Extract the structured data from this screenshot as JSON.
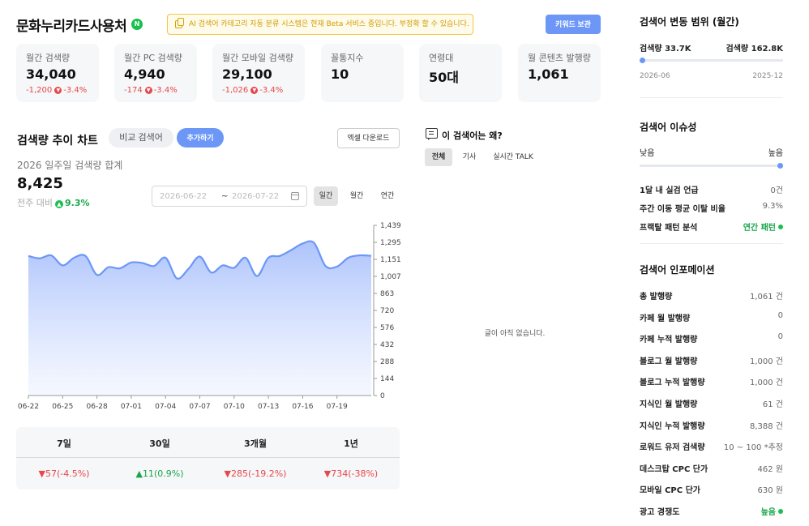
{
  "header": {
    "keyword": "문화누리카드사용처",
    "badge": "N",
    "beta_notice": "AI 검색어 카테고리 자동 분류 시스템은 현재 Beta 서비스 중입니다. 부정확 할 수 있습니다.",
    "report_button": "키워드 보관"
  },
  "stats": [
    {
      "label": "월간 검색량",
      "value": "34,040",
      "change": "-1,200",
      "change_pct": "-3.4%"
    },
    {
      "label": "월간 PC 검색량",
      "value": "4,940",
      "change": "-174",
      "change_pct": "-3.4%"
    },
    {
      "label": "월간 모바일 검색량",
      "value": "29,100",
      "change": "-1,026",
      "change_pct": "-3.4%"
    },
    {
      "label": "꼴통지수",
      "value": "10"
    },
    {
      "label": "연령대",
      "value": "50대"
    },
    {
      "label": "월 콘텐츠 발행량",
      "value": "1,061"
    }
  ],
  "trend": {
    "title": "검색량 추이 차트",
    "compare_button": "비교 검색어",
    "add_button": "추가하기",
    "excel_button": "엑셀 다운로드",
    "week_label": "2026 일주일 검색량 합계",
    "week_value": "8,425",
    "prev_week_label": "전주 대비",
    "prev_week_pct": "9.3%",
    "date_from": "2026-06-22",
    "date_sep": "~",
    "date_to": "2026-07-22",
    "periods": [
      "일간",
      "월간",
      "연간"
    ]
  },
  "chart_data": {
    "type": "area",
    "x": [
      "06-22",
      "06-23",
      "06-24",
      "06-25",
      "06-26",
      "06-27",
      "06-28",
      "06-29",
      "06-30",
      "07-01",
      "07-02",
      "07-03",
      "07-04",
      "07-05",
      "07-06",
      "07-07",
      "07-08",
      "07-09",
      "07-10",
      "07-11",
      "07-12",
      "07-13",
      "07-14",
      "07-15",
      "07-16",
      "07-17",
      "07-18",
      "07-19",
      "07-20",
      "07-21",
      "07-22"
    ],
    "values": [
      1180,
      1160,
      1185,
      1100,
      1165,
      1180,
      1020,
      1085,
      1075,
      1125,
      1120,
      1095,
      1165,
      990,
      1070,
      1175,
      1040,
      1100,
      1080,
      1165,
      1010,
      1165,
      1180,
      1230,
      1285,
      1290,
      1095,
      1090,
      1165,
      1185,
      1181
    ],
    "x_ticks": [
      "06-22",
      "06-25",
      "06-28",
      "07-01",
      "07-04",
      "07-07",
      "07-10",
      "07-13",
      "07-16",
      "07-19"
    ],
    "y_ticks": [
      "1,439",
      "1,295",
      "1,151",
      "1,007",
      "863",
      "720",
      "576",
      "432",
      "288",
      "144",
      "0"
    ],
    "ylim": [
      0,
      1439
    ],
    "grid": false,
    "color": "#6c97f7"
  },
  "period_changes": [
    {
      "label": "7일",
      "value": "▼57(-4.5%)",
      "dir": "down"
    },
    {
      "label": "30일",
      "value": "▲11(0.9%)",
      "dir": "up"
    },
    {
      "label": "3개월",
      "value": "▼285(-19.2%)",
      "dir": "down"
    },
    {
      "label": "1년",
      "value": "▼734(-38%)",
      "dir": "down"
    }
  ],
  "why": {
    "title": "이 검색어는 왜?",
    "tabs": [
      "전체",
      "기사",
      "실시간 TALK"
    ],
    "empty": "글이 아직 없습니다."
  },
  "range": {
    "title": "검색어 변동 범위 (월간)",
    "min_label": "검색량 33.7K",
    "max_label": "검색량 162.8K",
    "current_fraction": 0.0,
    "start": "2026-06",
    "end": "2025-12"
  },
  "issue": {
    "title": "검색어 이슈성",
    "low": "낮음",
    "high": "높음",
    "level_fraction": 1.0,
    "rows": [
      {
        "k": "1달 내 실검 언급",
        "v": "0건"
      },
      {
        "k": "주간 이동 평균 이탈 비율",
        "v": "9.3%"
      },
      {
        "k": "프랙탈 패턴 분석",
        "v": "연간 패턴",
        "green": true
      }
    ]
  },
  "info": {
    "title": "검색어 인포메이션",
    "rows": [
      {
        "k": "총 발행량",
        "v": "1,061 건"
      },
      {
        "k": "카페 월 발행량",
        "v": "0"
      },
      {
        "k": "카페 누적 발행량",
        "v": "0"
      },
      {
        "k": "블로그 월 발행량",
        "v": "1,000 건"
      },
      {
        "k": "블로그 누적 발행량",
        "v": "1,000 건"
      },
      {
        "k": "지식인 월 발행량",
        "v": "61 건"
      },
      {
        "k": "지식인 누적 발행량",
        "v": "8,388 건"
      },
      {
        "k": "로워드 유저 검색량",
        "v": "10 ~ 100 *추정"
      },
      {
        "k": "데스크탑 CPC 단가",
        "v": "462 원"
      },
      {
        "k": "모바일 CPC 단가",
        "v": "630 원"
      },
      {
        "k": "광고 경쟁도",
        "v": "높음",
        "green": true
      }
    ]
  }
}
